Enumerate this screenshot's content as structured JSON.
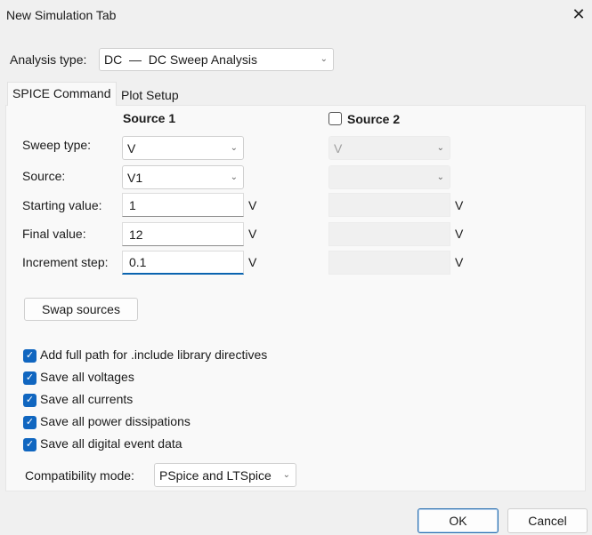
{
  "window": {
    "title": "New Simulation Tab",
    "close_icon": "close-icon"
  },
  "analysis": {
    "label": "Analysis type:",
    "value": "DC  —  DC Sweep Analysis"
  },
  "tabs": [
    {
      "label": "SPICE Command",
      "active": true
    },
    {
      "label": "Plot Setup",
      "active": false
    }
  ],
  "source1": {
    "header": "Source 1",
    "sweep_type": "V",
    "source": "V1",
    "start": "1",
    "final": "12",
    "step": "0.1"
  },
  "source2": {
    "header": "Source 2",
    "checked": false,
    "sweep_type": "V",
    "source": "",
    "start": "",
    "final": "",
    "step": ""
  },
  "rows": {
    "sweep_type": "Sweep type:",
    "source": "Source:",
    "start": "Starting value:",
    "final": "Final value:",
    "step": "Increment step:"
  },
  "unit": "V",
  "swap_label": "Swap sources",
  "options": [
    {
      "label": "Add full path for .include library directives",
      "checked": true
    },
    {
      "label": "Save all voltages",
      "checked": true
    },
    {
      "label": "Save all currents",
      "checked": true
    },
    {
      "label": "Save all power dissipations",
      "checked": true
    },
    {
      "label": "Save all digital event data",
      "checked": true
    }
  ],
  "compat": {
    "label": "Compatibility mode:",
    "value": "PSpice and LTSpice"
  },
  "buttons": {
    "ok": "OK",
    "cancel": "Cancel"
  },
  "colors": {
    "accent": "#1066c0"
  }
}
